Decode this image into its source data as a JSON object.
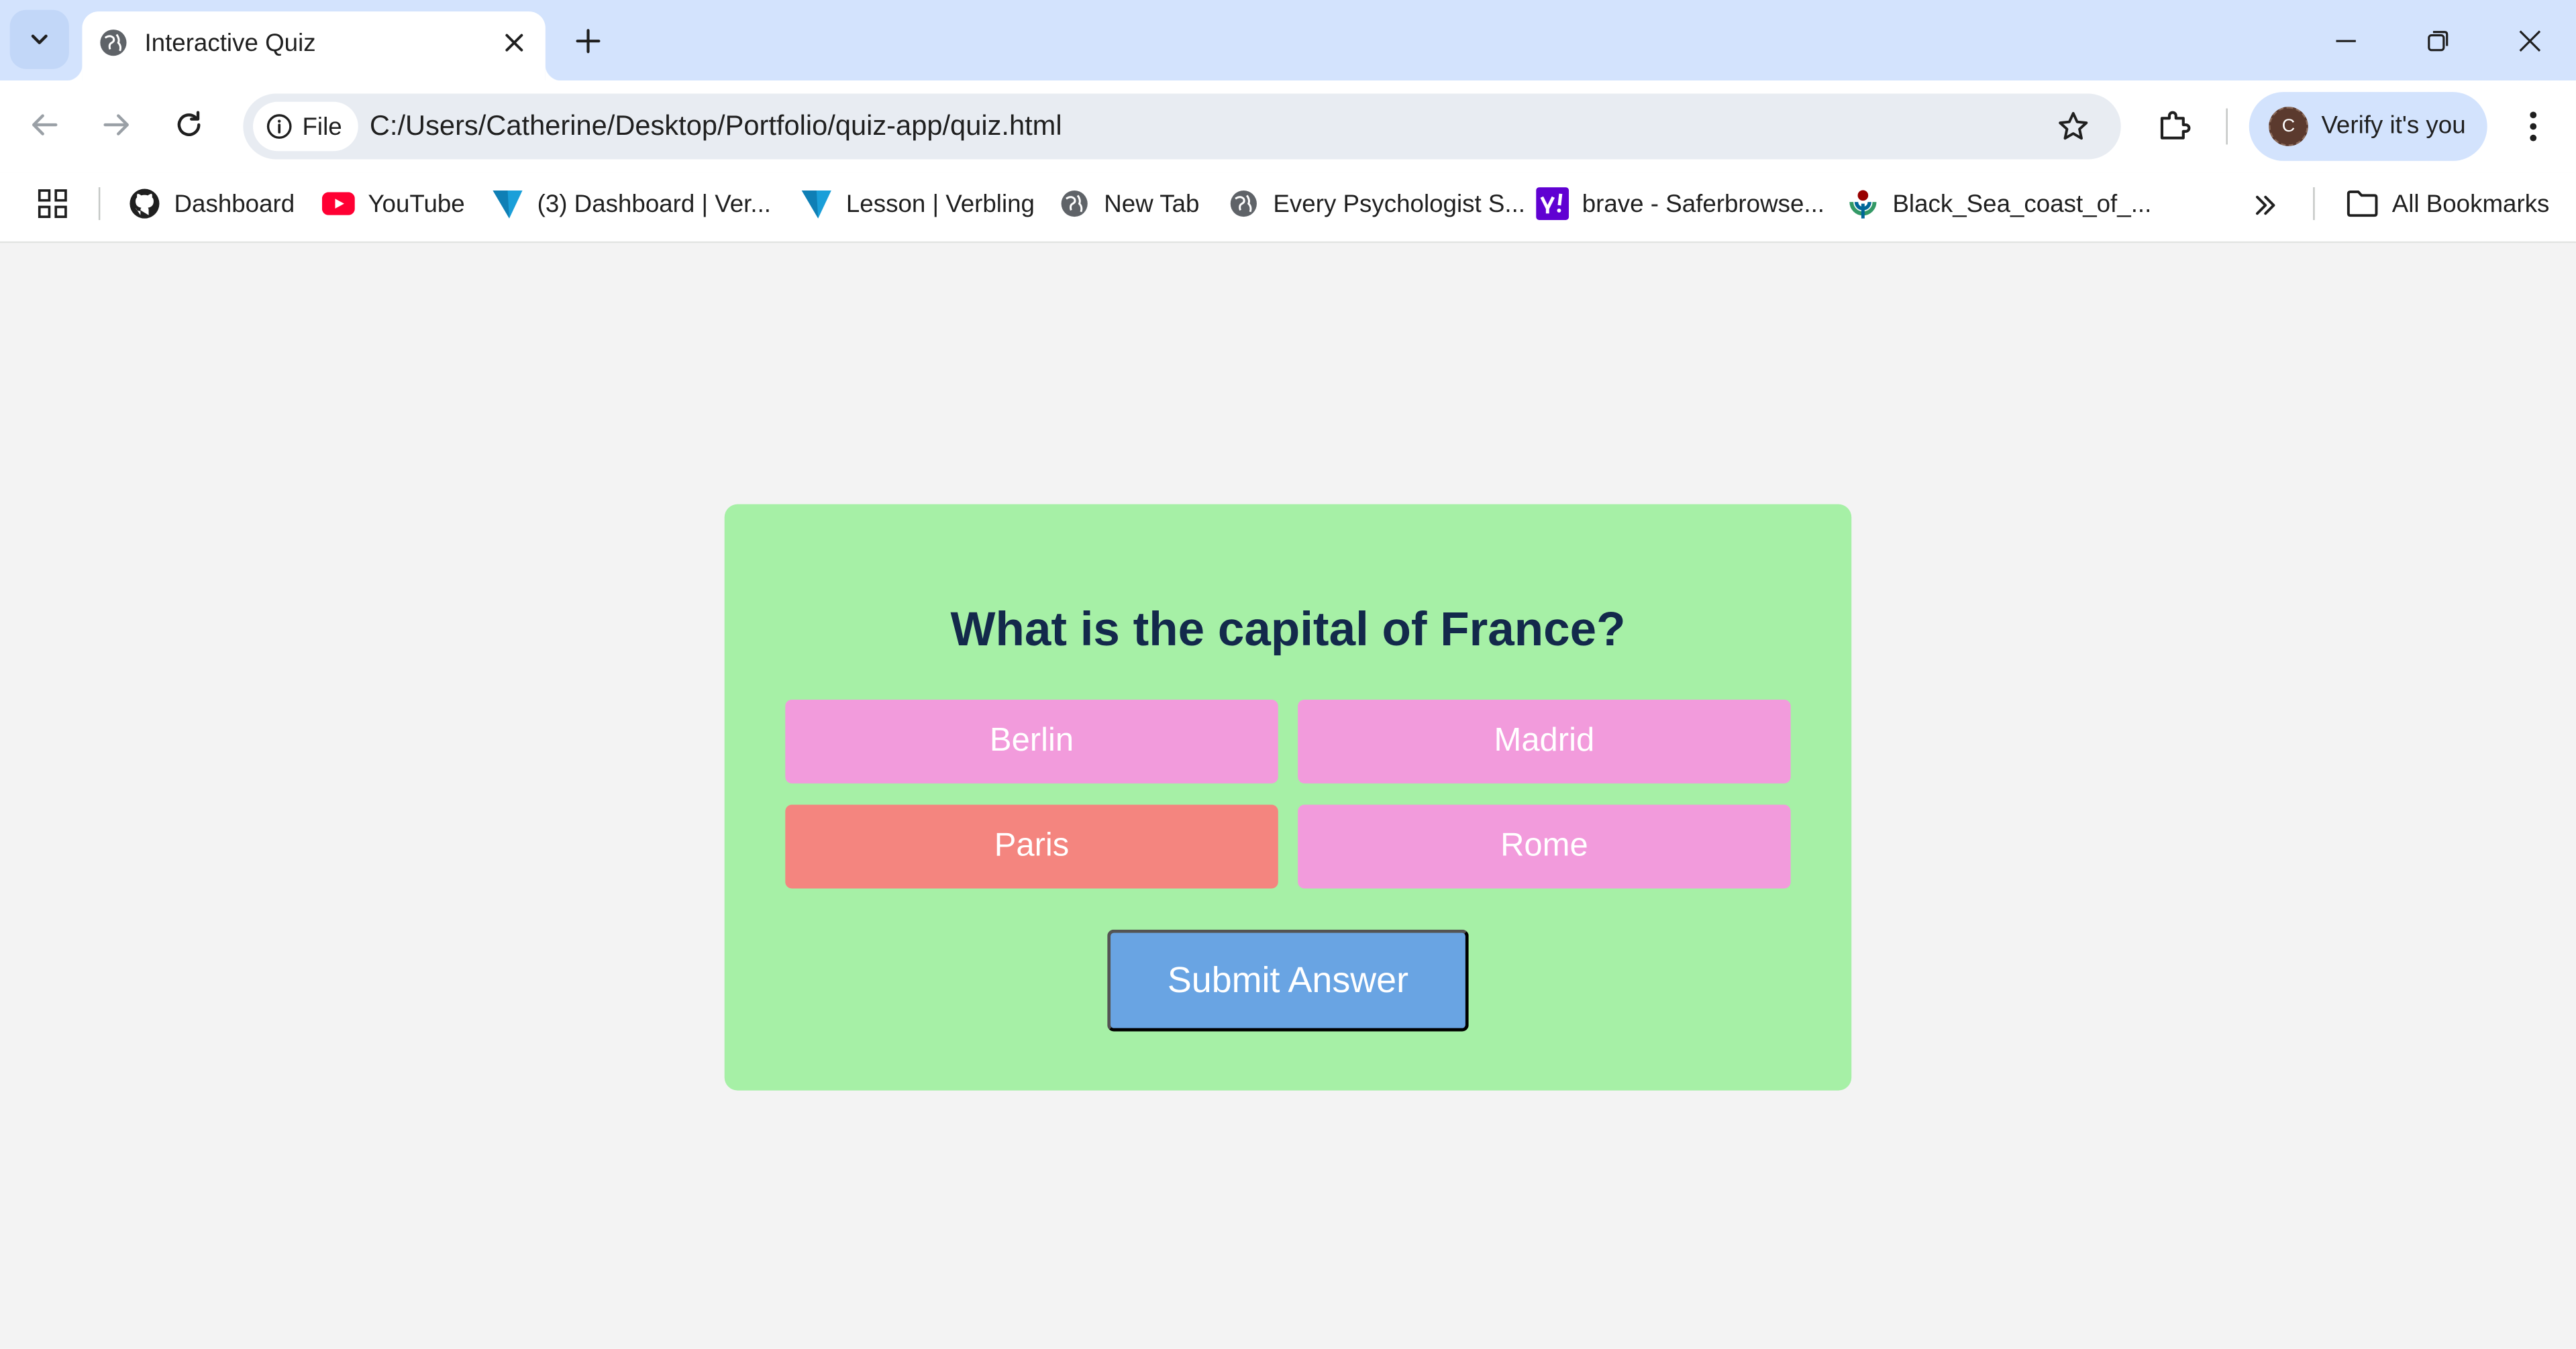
{
  "browser": {
    "tab": {
      "title": "Interactive Quiz"
    },
    "address_bar": {
      "site_chip_label": "File",
      "url": "C:/Users/Catherine/Desktop/Portfolio/quiz-app/quiz.html"
    },
    "profile": {
      "avatar_letter": "C",
      "label": "Verify it's you"
    },
    "bookmarks": [
      {
        "label": "Dashboard",
        "icon": "github-icon"
      },
      {
        "label": "YouTube",
        "icon": "youtube-icon"
      },
      {
        "label": "(3) Dashboard | Ver...",
        "icon": "verbling-icon"
      },
      {
        "label": "Lesson | Verbling",
        "icon": "verbling-icon"
      },
      {
        "label": "New Tab",
        "icon": "globe-icon"
      },
      {
        "label": "Every Psychologist S...",
        "icon": "globe-icon"
      },
      {
        "label": "brave - Saferbrowse...",
        "icon": "yahoo-icon"
      },
      {
        "label": "Black_Sea_coast_of_...",
        "icon": "wikimedia-icon"
      }
    ],
    "all_bookmarks_label": "All Bookmarks",
    "colors": {
      "tabstrip": "#d3e3fd",
      "toolbar": "#ffffff",
      "omnibox": "#e8ecf2"
    }
  },
  "quiz": {
    "question": "What is the capital of France?",
    "options": [
      {
        "label": "Berlin",
        "selected": false
      },
      {
        "label": "Madrid",
        "selected": false
      },
      {
        "label": "Paris",
        "selected": true
      },
      {
        "label": "Rome",
        "selected": false
      }
    ],
    "submit_label": "Submit Answer",
    "colors": {
      "card": "#a6f0a6",
      "option": "#f29bdc",
      "option_selected": "#f4857f",
      "submit": "#69a4e3",
      "question_text": "#13294b"
    }
  }
}
